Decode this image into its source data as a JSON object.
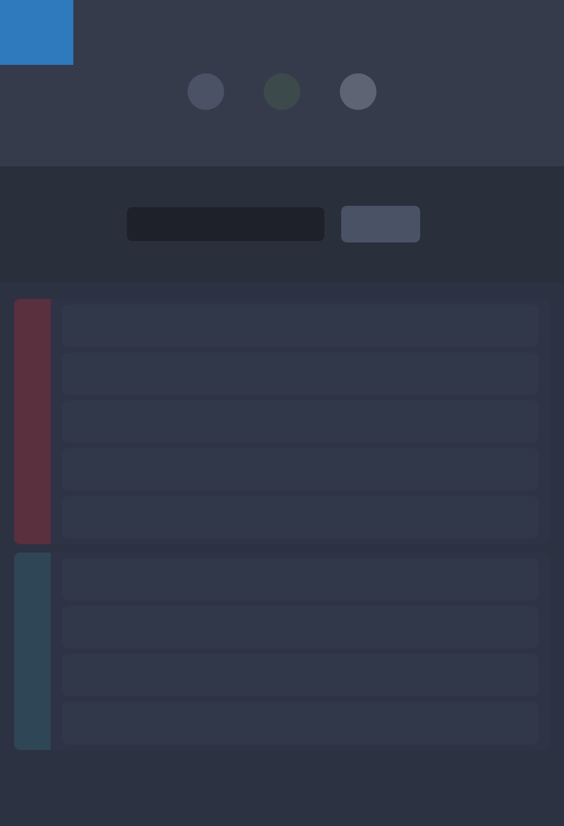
{
  "sections": [
    {
      "color": "#5a2f3e"
    },
    {
      "color": "#2f4656"
    }
  ]
}
